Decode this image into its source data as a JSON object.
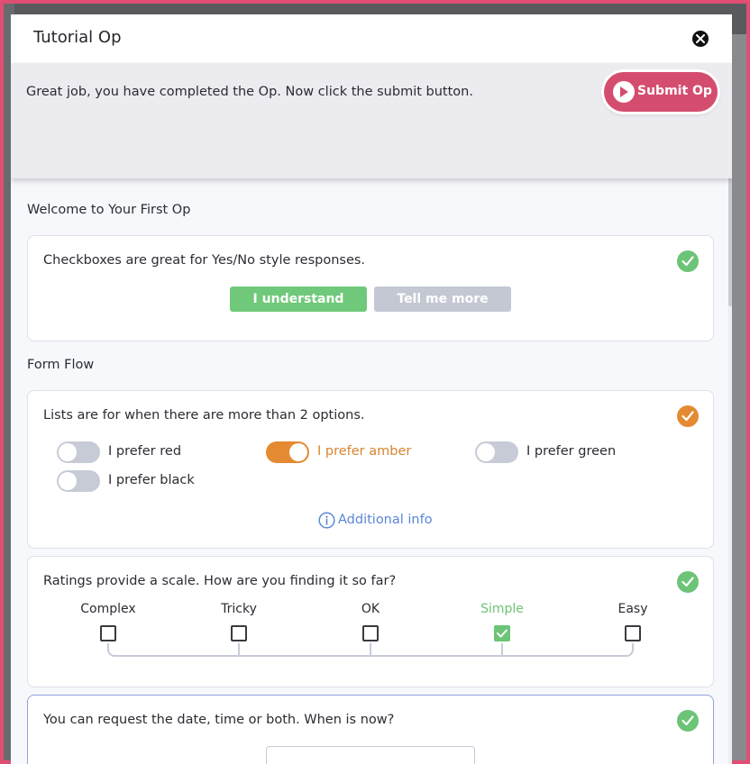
{
  "modal": {
    "title": "Tutorial Op"
  },
  "banner": {
    "message": "Great job, you have completed the Op. Now click the submit button.",
    "submit_label": "Submit Op"
  },
  "sections": {
    "welcome_title": "Welcome to Your First Op",
    "form_flow_title": "Form Flow"
  },
  "checkbox_card": {
    "question": "Checkboxes are great for Yes/No style responses.",
    "primary_label": "I understand",
    "secondary_label": "Tell me more",
    "status": "complete"
  },
  "list_card": {
    "question": "Lists are for when there are more than 2 options.",
    "options": [
      {
        "label": "I prefer red",
        "on": false
      },
      {
        "label": "I prefer amber",
        "on": true
      },
      {
        "label": "I prefer green",
        "on": false
      },
      {
        "label": "I prefer black",
        "on": false
      }
    ],
    "info_label": "Additional info",
    "status": "complete"
  },
  "rating_card": {
    "question": "Ratings provide a scale. How are you finding it so far?",
    "options": [
      "Complex",
      "Tricky",
      "OK",
      "Simple",
      "Easy"
    ],
    "selected": "Simple",
    "status": "complete"
  },
  "date_card": {
    "question": "You can request the date, time or both. When is now?",
    "status": "complete"
  },
  "colors": {
    "brand": "#d44d6f",
    "success": "#6cc477",
    "amber": "#e48a33",
    "link": "#5a87d8",
    "muted": "#c3c8d3"
  },
  "icons": {
    "close": "close-icon",
    "play": "play-icon",
    "check": "check-circle-icon",
    "info": "info-icon"
  }
}
